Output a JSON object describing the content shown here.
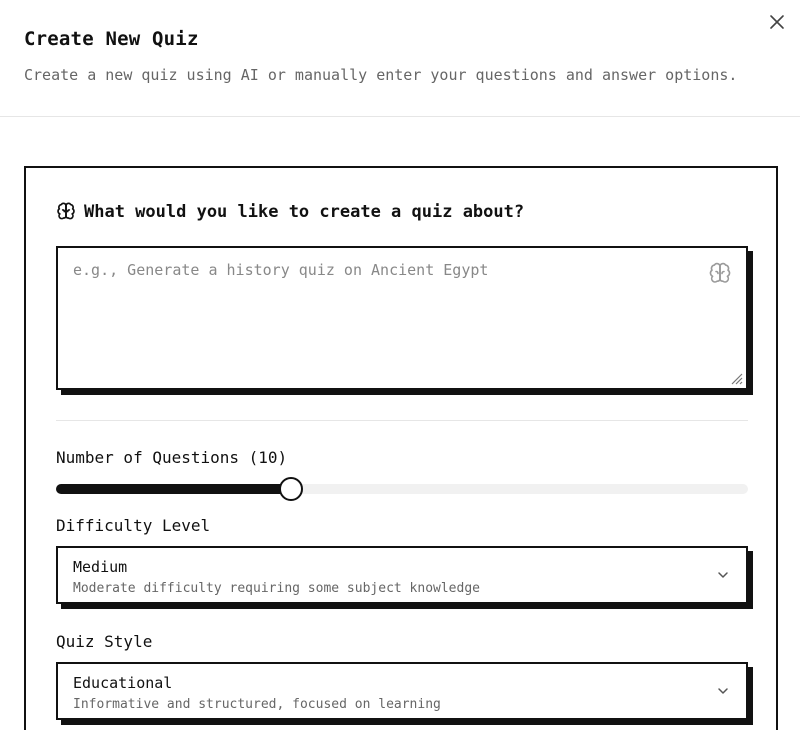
{
  "dialog": {
    "title": "Create New Quiz",
    "description": "Create a new quiz using AI or manually enter your questions and answer options.",
    "close_icon": "close-icon"
  },
  "prompt": {
    "heading": "What would you like to create a quiz about?",
    "heading_icon": "brain-icon",
    "placeholder": "e.g., Generate a history quiz on Ancient Egypt",
    "value": "",
    "action_icon": "brain-icon"
  },
  "questions": {
    "label": "Number of Questions (10)",
    "value": 10,
    "fill_fraction": 0.34
  },
  "difficulty": {
    "label": "Difficulty Level",
    "selected_title": "Medium",
    "selected_description": "Moderate difficulty requiring some subject knowledge",
    "icon": "chevron-down-icon"
  },
  "style": {
    "label": "Quiz Style",
    "selected_title": "Educational",
    "selected_description": "Informative and structured, focused on learning",
    "icon": "chevron-down-icon"
  },
  "colors": {
    "accent": "#111111",
    "muted_text": "#666666",
    "track": "#f1f1f1",
    "divider": "#e6e6e6"
  }
}
